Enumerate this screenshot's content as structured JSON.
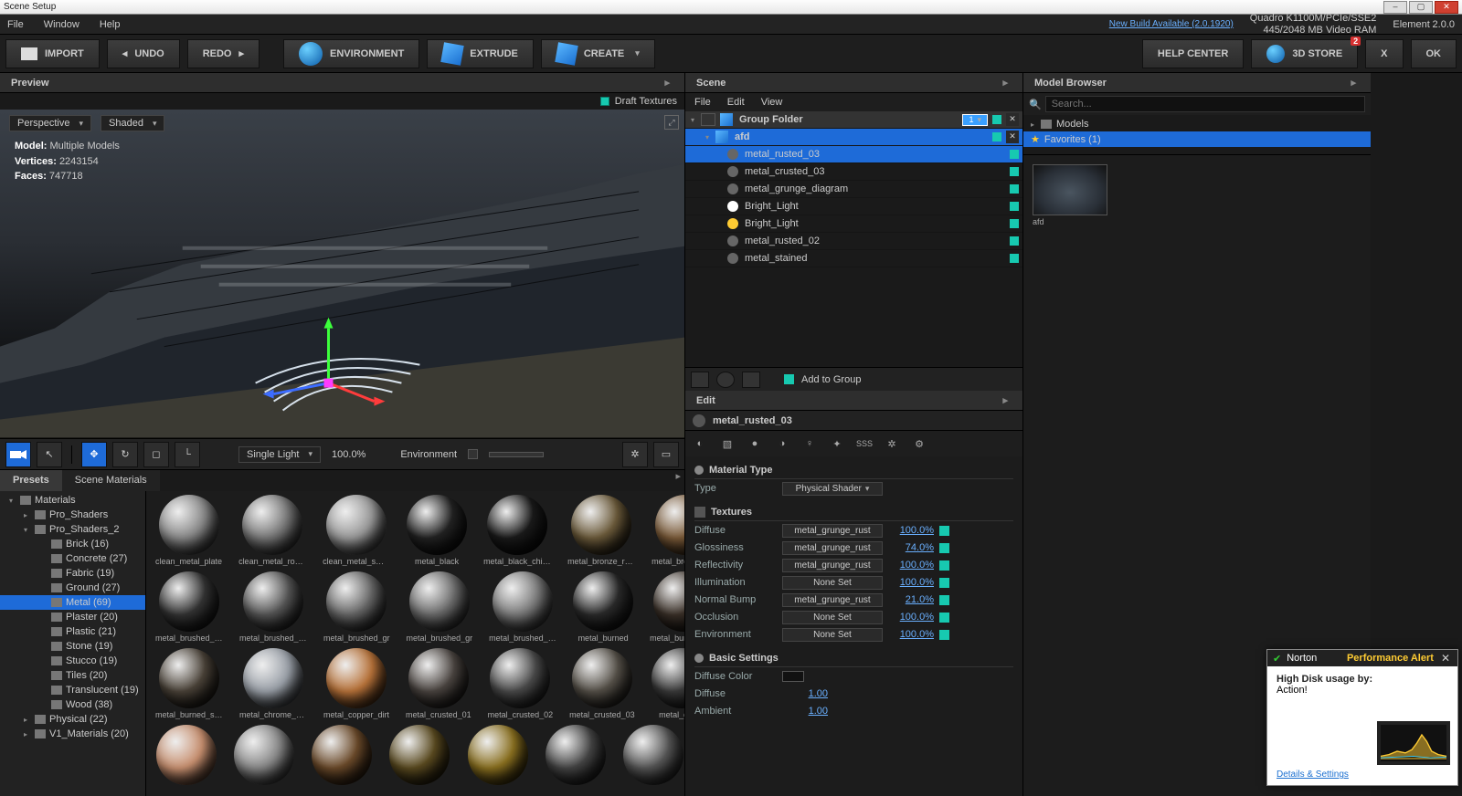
{
  "window": {
    "title": "Scene Setup"
  },
  "menubar": {
    "items": [
      "File",
      "Window",
      "Help"
    ],
    "update_link": "New Build Available (2.0.1920)",
    "gpu_line1": "Quadro K1100M/PCIe/SSE2",
    "gpu_line2": "445/2048 MB Video RAM",
    "product": "Element",
    "version": "2.0.0"
  },
  "toolbar": {
    "import": "IMPORT",
    "undo": "UNDO",
    "redo": "REDO",
    "environment": "ENVIRONMENT",
    "extrude": "EXTRUDE",
    "create": "CREATE",
    "help": "HELP CENTER",
    "store": "3D STORE",
    "store_badge": "2",
    "x": "X",
    "ok": "OK"
  },
  "preview": {
    "title": "Preview",
    "draft": "Draft Textures",
    "camera": "Perspective",
    "shading": "Shaded",
    "stats": {
      "model_label": "Model:",
      "model": "Multiple Models",
      "verts_label": "Vertices:",
      "verts": "2243154",
      "faces_label": "Faces:",
      "faces": "747718"
    },
    "light_mode": "Single Light",
    "light_pct": "100.0%",
    "env_label": "Environment"
  },
  "presets": {
    "tab_presets": "Presets",
    "tab_scene": "Scene Materials",
    "tree": [
      {
        "l": 1,
        "exp": "d",
        "label": "Materials"
      },
      {
        "l": 2,
        "exp": "r",
        "label": "Pro_Shaders"
      },
      {
        "l": 2,
        "exp": "d",
        "label": "Pro_Shaders_2"
      },
      {
        "l": 3,
        "label": "Brick (16)"
      },
      {
        "l": 3,
        "label": "Concrete (27)"
      },
      {
        "l": 3,
        "label": "Fabric (19)"
      },
      {
        "l": 3,
        "label": "Ground (27)"
      },
      {
        "l": 3,
        "label": "Metal (69)",
        "sel": true
      },
      {
        "l": 3,
        "label": "Plaster (20)"
      },
      {
        "l": 3,
        "label": "Plastic (21)"
      },
      {
        "l": 3,
        "label": "Stone (19)"
      },
      {
        "l": 3,
        "label": "Stucco (19)"
      },
      {
        "l": 3,
        "label": "Tiles (20)"
      },
      {
        "l": 3,
        "label": "Translucent (19)"
      },
      {
        "l": 3,
        "label": "Wood (38)"
      },
      {
        "l": 2,
        "exp": "r",
        "label": "Physical (22)"
      },
      {
        "l": 2,
        "exp": "r",
        "label": "V1_Materials (20)"
      }
    ],
    "grid": [
      [
        "clean_metal_plate",
        "clean_metal_rough",
        "clean_metal_smoo",
        "metal_black",
        "metal_black_chips",
        "metal_bronze_raw",
        "metal_bronze_rust"
      ],
      [
        "metal_brushed_bla",
        "metal_brushed_din",
        "metal_brushed_gr",
        "metal_brushed_gr",
        "metal_brushed_pla",
        "metal_burned",
        "metal_burned_dea"
      ],
      [
        "metal_burned_scat",
        "metal_chrome_dirt",
        "metal_copper_dirt",
        "metal_crusted_01",
        "metal_crusted_02",
        "metal_crusted_03",
        "metal_dents"
      ],
      [
        "",
        "",
        "",
        "",
        "",
        "",
        ""
      ]
    ],
    "ball_tints": [
      [
        "#888",
        "#777",
        "#999",
        "#222",
        "#1a1a1a",
        "#6b5a3a",
        "#7a5a38"
      ],
      [
        "#333",
        "#555",
        "#666",
        "#6a6a6a",
        "#7a7a7a",
        "#2a2a2a",
        "#3a3028"
      ],
      [
        "#4a4238",
        "#9aa0a8",
        "#b8733a",
        "#4a4440",
        "#4a4a4a",
        "#555048",
        "#3a3a3a"
      ],
      [
        "#c89070",
        "#888",
        "#6b4a2a",
        "#5a4a20",
        "#8a7020",
        "#444",
        "#555"
      ]
    ]
  },
  "scene": {
    "title": "Scene",
    "menu": [
      "File",
      "Edit",
      "View"
    ],
    "group": "Group Folder",
    "group_badge": "1",
    "afd": "afd",
    "items": [
      {
        "icon": "sph",
        "name": "metal_rusted_03",
        "sel": true
      },
      {
        "icon": "sph",
        "name": "metal_crusted_03"
      },
      {
        "icon": "sph",
        "name": "metal_grunge_diagram"
      },
      {
        "icon": "lw",
        "name": "Bright_Light"
      },
      {
        "icon": "ly",
        "name": "Bright_Light"
      },
      {
        "icon": "sph",
        "name": "metal_rusted_02"
      },
      {
        "icon": "sph",
        "name": "metal_stained"
      }
    ],
    "add_group": "Add to Group"
  },
  "edit": {
    "title": "Edit",
    "material": "metal_rusted_03",
    "mat_type_h": "Material Type",
    "type_label": "Type",
    "type_value": "Physical Shader",
    "tex_h": "Textures",
    "rows": [
      {
        "label": "Diffuse",
        "value": "metal_grunge_rust",
        "pct": "100.0%"
      },
      {
        "label": "Glossiness",
        "value": "metal_grunge_rust",
        "pct": "74.0%"
      },
      {
        "label": "Reflectivity",
        "value": "metal_grunge_rust",
        "pct": "100.0%"
      },
      {
        "label": "Illumination",
        "value": "None Set",
        "pct": "100.0%"
      },
      {
        "label": "Normal Bump",
        "value": "metal_grunge_rust",
        "pct": "21.0%"
      },
      {
        "label": "Occlusion",
        "value": "None Set",
        "pct": "100.0%"
      },
      {
        "label": "Environment",
        "value": "None Set",
        "pct": "100.0%"
      }
    ],
    "basic_h": "Basic Settings",
    "diffuse_color": "Diffuse Color",
    "diffuse": "Diffuse",
    "diffuse_v": "1.00",
    "ambient": "Ambient",
    "ambient_v": "1.00"
  },
  "browser": {
    "title": "Model Browser",
    "search_ph": "Search...",
    "models": "Models",
    "favorites": "Favorites (1)",
    "thumb": "afd"
  },
  "norton": {
    "brand": "Norton",
    "alert": "Performance Alert",
    "line1": "High Disk usage by:",
    "app": "Action!",
    "link": "Details & Settings"
  }
}
